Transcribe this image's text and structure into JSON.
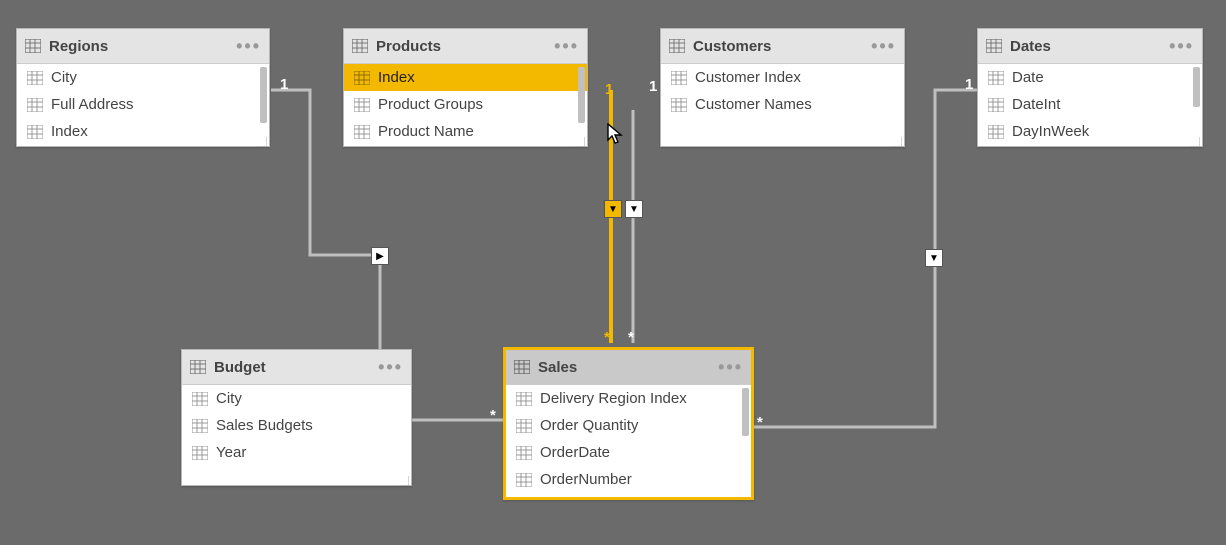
{
  "cardinality": {
    "one": "1",
    "many": "*"
  },
  "tables": {
    "regions": {
      "name": "Regions",
      "fields": [
        "City",
        "Full Address",
        "Index"
      ]
    },
    "products": {
      "name": "Products",
      "fields": [
        "Index",
        "Product Groups",
        "Product Name"
      ],
      "selected_field_index": 0
    },
    "customers": {
      "name": "Customers",
      "fields": [
        "Customer Index",
        "Customer Names"
      ]
    },
    "dates": {
      "name": "Dates",
      "fields": [
        "Date",
        "DateInt",
        "DayInWeek"
      ]
    },
    "budget": {
      "name": "Budget",
      "fields": [
        "City",
        "Sales Budgets",
        "Year"
      ]
    },
    "sales": {
      "name": "Sales",
      "fields": [
        "Delivery Region Index",
        "Order Quantity",
        "OrderDate",
        "OrderNumber"
      ],
      "selected": true
    }
  },
  "relationships": [
    {
      "from": "regions",
      "to": "budget",
      "from_card": "1",
      "to_card": "*",
      "direction": "single"
    },
    {
      "from": "budget",
      "to": "sales",
      "from_card": "*",
      "to_card": "*",
      "direction": "single"
    },
    {
      "from": "products",
      "to": "sales",
      "from_card": "1",
      "to_card": "*",
      "direction": "single",
      "highlighted": true
    },
    {
      "from": "customers",
      "to": "sales",
      "from_card": "1",
      "to_card": "*",
      "direction": "single"
    },
    {
      "from": "dates",
      "to": "sales",
      "from_card": "1",
      "to_card": "*",
      "direction": "single"
    }
  ],
  "colors": {
    "accent": "#f3b900",
    "canvas": "#6b6b6b",
    "box_header": "#e4e4e4",
    "box_header_sel": "#c9c9c9"
  }
}
